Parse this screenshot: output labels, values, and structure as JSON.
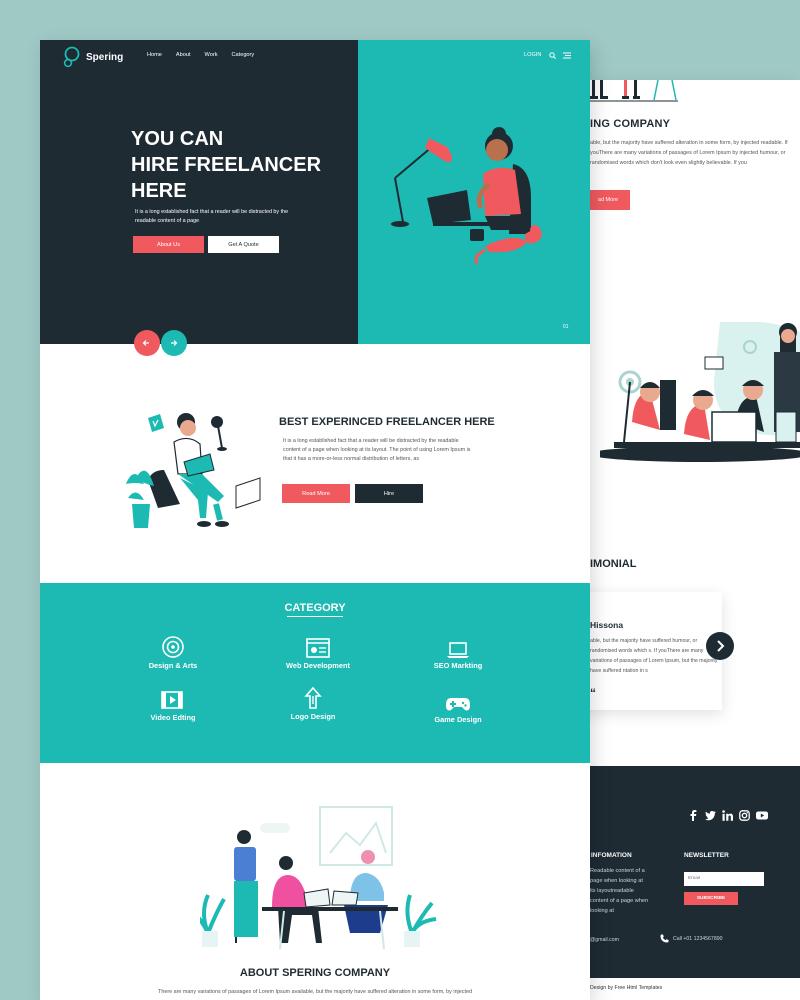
{
  "brand": {
    "name": "Spering"
  },
  "nav": {
    "items": [
      "Home",
      "About",
      "Work",
      "Category"
    ],
    "login": "LOGIN"
  },
  "hero": {
    "title_lines": [
      "YOU CAN",
      "HIRE FREELANCER",
      "HERE"
    ],
    "text": "It is a long established fact that a reader will be distracted by the readable content of a page",
    "btn_about": "About Us",
    "btn_quote": "Get A Quote",
    "slide_number": "01"
  },
  "freelancer": {
    "title": "BEST EXPERINCED FREELANCER HERE",
    "text": "It is a long established fact that a reader will be distracted by the readable content of a page when looking at its layout. The point of using Lorem Ipsum is that it has a more-or-less normal distribution of letters, as",
    "btn_read": "Read More",
    "btn_hire": "Hire"
  },
  "category": {
    "title": "CATEGORY",
    "items": [
      {
        "label": "Design & Arts",
        "icon": "target-icon"
      },
      {
        "label": "Web Development",
        "icon": "browser-icon"
      },
      {
        "label": "SEO Markting",
        "icon": "laptop-icon"
      },
      {
        "label": "Video Edting",
        "icon": "film-icon"
      },
      {
        "label": "Logo Design",
        "icon": "upload-icon"
      },
      {
        "label": "Game Design",
        "icon": "gamepad-icon"
      }
    ]
  },
  "about": {
    "title": "ABOUT SPERING COMPANY",
    "text": "There are many variations of passages of Lorem Ipsum available, but the majority have suffered alteration in some form, by injected"
  },
  "back_page": {
    "company_title": "ING COMPANY",
    "company_text": "able, but the majority have suffered alteration in some form, by injected readable. If youThere are many variations of passages of Lorem Ipsum by injected humour, or randomised words which don't look even slightly believable. If you",
    "read_more": "ad More",
    "fragment": "r",
    "testimonial_title": "IMONIAL",
    "testimonial_name": "Hissona",
    "testimonial_text": "able, but the majority have suffered humour, or randomised words which s. If youThere are many variations of passages of Lorem Ipsum, but the majority have suffered ntation in s",
    "quote_mark": "“",
    "info_title": "INFOMATION",
    "info_text": "Readable content of a page when looking at its layoutreadable content of a page when looking at",
    "newsletter_title": "NEWSLETTER",
    "email_placeholder": "Email",
    "subscribe": "SUBSCRIBE",
    "mail": "@gmail.com",
    "phone": "Call +01 1234567890",
    "copyright": "Design by Free Html Templates"
  },
  "colors": {
    "dark": "#1e2b33",
    "teal": "#1cbab2",
    "red": "#f05a5e",
    "background": "#9fc9c5"
  }
}
